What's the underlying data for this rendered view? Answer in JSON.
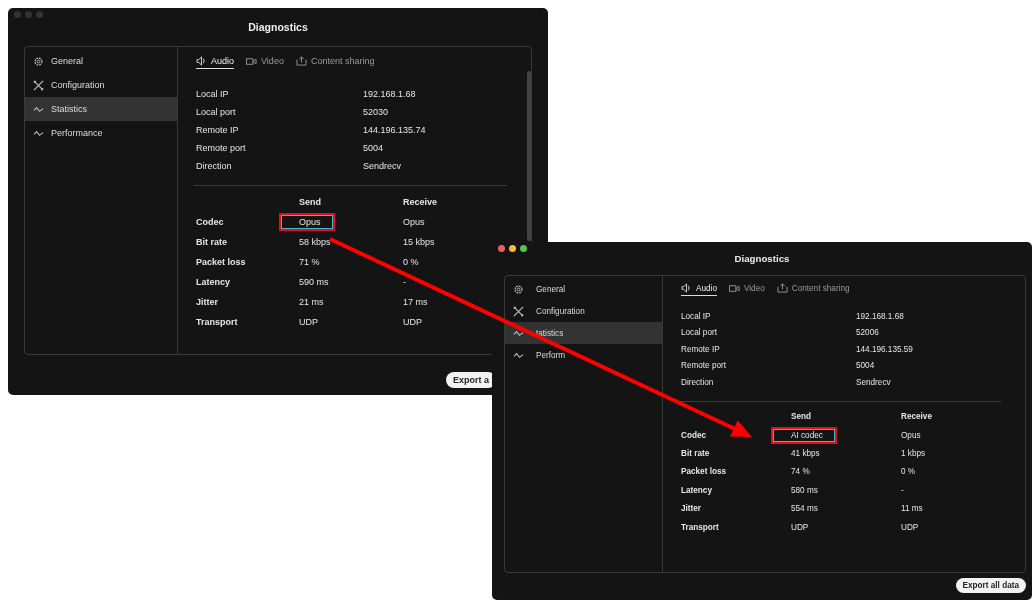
{
  "windows": [
    {
      "title": "Diagnostics",
      "active": false,
      "scrollbar": true,
      "sidebar": [
        {
          "label": "General",
          "selected": false
        },
        {
          "label": "Configuration",
          "selected": false
        },
        {
          "label": "Statistics",
          "selected": true
        },
        {
          "label": "Performance",
          "selected": false
        }
      ],
      "tabs": [
        {
          "label": "Audio",
          "selected": true
        },
        {
          "label": "Video",
          "selected": false
        },
        {
          "label": "Content sharing",
          "selected": false
        }
      ],
      "info": [
        {
          "label": "Local IP",
          "value": "192.168.1.68"
        },
        {
          "label": "Local port",
          "value": "52030"
        },
        {
          "label": "Remote IP",
          "value": "144.196.135.74"
        },
        {
          "label": "Remote port",
          "value": "5004"
        },
        {
          "label": "Direction",
          "value": "Sendrecv"
        }
      ],
      "stats": {
        "columns": [
          "Send",
          "Receive"
        ],
        "rows": [
          {
            "label": "Codec",
            "send": "Opus",
            "receive": "Opus",
            "highlighted": true
          },
          {
            "label": "Bit rate",
            "send": "58 kbps",
            "receive": "15 kbps",
            "highlighted": false
          },
          {
            "label": "Packet loss",
            "send": "71 %",
            "receive": "0 %",
            "highlighted": false
          },
          {
            "label": "Latency",
            "send": "590 ms",
            "receive": "-",
            "highlighted": false
          },
          {
            "label": "Jitter",
            "send": "21 ms",
            "receive": "17 ms",
            "highlighted": false
          },
          {
            "label": "Transport",
            "send": "UDP",
            "receive": "UDP",
            "highlighted": false
          }
        ]
      },
      "export_button": "Export a"
    },
    {
      "title": "Diagnostics",
      "active": true,
      "scrollbar": false,
      "sidebar": [
        {
          "label": "General",
          "selected": false
        },
        {
          "label": "Configuration",
          "selected": false
        },
        {
          "label": "tatistics",
          "selected": true
        },
        {
          "label": "Perform",
          "selected": false
        }
      ],
      "tabs": [
        {
          "label": "Audio",
          "selected": true
        },
        {
          "label": "Video",
          "selected": false
        },
        {
          "label": "Content sharing",
          "selected": false
        }
      ],
      "info": [
        {
          "label": "Local IP",
          "value": "192.168.1.68"
        },
        {
          "label": "Local port",
          "value": "52006"
        },
        {
          "label": "Remote IP",
          "value": "144.196.135.59"
        },
        {
          "label": "Remote port",
          "value": "5004"
        },
        {
          "label": "Direction",
          "value": "Sendrecv"
        }
      ],
      "stats": {
        "columns": [
          "Send",
          "Receive"
        ],
        "rows": [
          {
            "label": "Codec",
            "send": "AI codec",
            "receive": "Opus",
            "highlighted": true
          },
          {
            "label": "Bit rate",
            "send": "41 kbps",
            "receive": "1 kbps",
            "highlighted": false
          },
          {
            "label": "Packet loss",
            "send": "74 %",
            "receive": "0 %",
            "highlighted": false
          },
          {
            "label": "Latency",
            "send": "580 ms",
            "receive": "-",
            "highlighted": false
          },
          {
            "label": "Jitter",
            "send": "554 ms",
            "receive": "11 ms",
            "highlighted": false
          },
          {
            "label": "Transport",
            "send": "UDP",
            "receive": "UDP",
            "highlighted": false
          }
        ]
      },
      "export_button": "Export all data"
    }
  ]
}
